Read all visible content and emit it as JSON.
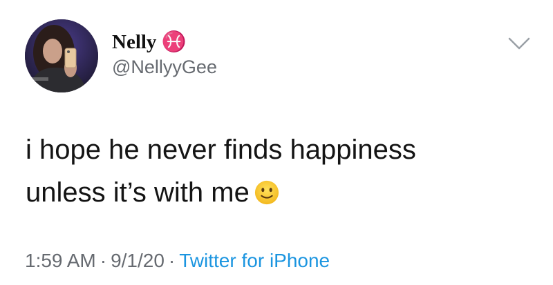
{
  "tweet": {
    "display_name": "Nelly ♓",
    "handle": "@NellyyGee",
    "text_lines": [
      "i hope he never finds happiness",
      "unless it’s with me"
    ],
    "emoji": "slightly-smiling-face",
    "time": "1:59 AM",
    "date": "9/1/20",
    "separator": "·",
    "source": "Twitter for iPhone"
  },
  "icons": {
    "menu": "chevron-down-icon",
    "avatar": "profile-photo"
  },
  "colors": {
    "link": "#1b95e0",
    "secondary_text": "#666a70",
    "primary_text": "#141414"
  }
}
